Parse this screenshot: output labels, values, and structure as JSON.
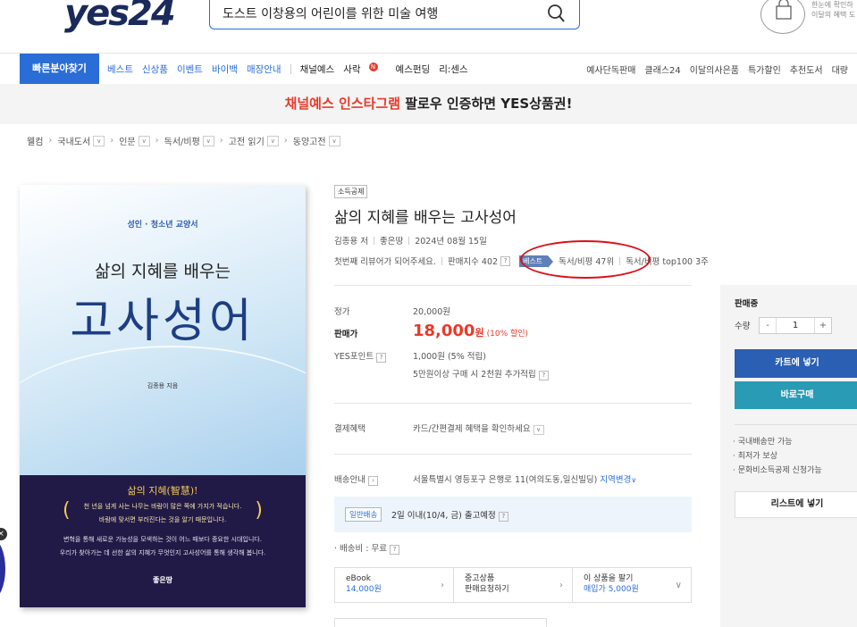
{
  "header": {
    "logo": "yes24",
    "search_value": "도스트 이창용의 어린이를 위한 미술 여행",
    "cart_hint_line1": "한눈에 확인하",
    "cart_hint_line2": "이달의 혜택 도"
  },
  "nav": {
    "quick_button": "빠른분야찾기",
    "items_blue": [
      "베스트",
      "신상품",
      "이벤트",
      "바이백",
      "매장안내"
    ],
    "items_dark": [
      "채널예스",
      "사락",
      "예스펀딩",
      "리:센스"
    ],
    "sarak_badge": "N",
    "items_right": [
      "예사단독판매",
      "클래스24",
      "이달의사은품",
      "특가할인",
      "추천도서",
      "대량"
    ]
  },
  "promo": {
    "red_text": "채널예스 인스타그램",
    "black_text": " 팔로우 인증하면 YES상품권!"
  },
  "breadcrumb": [
    "웰컴",
    "국내도서",
    "인문",
    "독서/비평",
    "고전 읽기",
    "동양고전"
  ],
  "cover": {
    "subtitle": "성인 · 청소년 교양서",
    "title_line1": "삶의 지혜를 배우는",
    "title_line2": "고사성어",
    "author": "김종용 지음",
    "bottom_title": "삶의 지혜(智慧)!",
    "bottom_line1": "천 년을 넘게 사는 나무는 바람이 많은 쪽에 가지가 적습니다.",
    "bottom_line2": "바람에 맞서면 부러진다는 것을 알기 때문입니다.",
    "bottom_line3": "변혁을 통해 새로운 가능성을 모색하는 것이 어느 때보다 중요한 시대입니다.",
    "bottom_line4": "우리가 찾아가는 데 선한 삶의 지혜가 무엇인지 고사성어를 통해 생각해 봅니다.",
    "publisher": "좋은땅"
  },
  "product": {
    "tag": "소득공제",
    "title": "삶의 지혜를 배우는 고사성어",
    "author": "김종용 저",
    "publisher": "좋은땅",
    "date": "2024년 08월 15일",
    "review_prompt": "첫번째 리뷰어가 되어주세요.",
    "sales_index": "판매지수 402",
    "best_badge": "베스트",
    "rank_text": "독서/비평 47위",
    "rank_top": "독서/비평 top100 3주"
  },
  "pricing": {
    "list_price_label": "정가",
    "list_price": "20,000원",
    "sale_label": "판매가",
    "sale_price": "18,000",
    "sale_unit": "원",
    "discount": "(10% 할인)",
    "points_label": "YES포인트",
    "points": "1,000원 (5% 적립)",
    "points_extra": "5만원이상 구매 시 2천원 추가적립"
  },
  "payment": {
    "label": "결제혜택",
    "value": "카드/간편결제 혜택을 확인하세요"
  },
  "delivery": {
    "label": "배송안내",
    "address": "서울특별시 영등포구 은행로 11(여의도동,일신빌딩)",
    "change": "지역변경",
    "type": "일반배송",
    "eta": "2일 이내(10/4, 금) 출고예정",
    "fee": "· 배송비 : 무료"
  },
  "cards": [
    {
      "title": "eBook",
      "sub": "14,000원"
    },
    {
      "title": "중고상품",
      "sub": "판매요청하기"
    },
    {
      "title": "이 상품을 팔기",
      "sub": "매입가 5,000원"
    }
  ],
  "side_panel": {
    "title": "판매중",
    "qty_label": "수량",
    "qty_value": "1",
    "minus": "-",
    "plus": "+",
    "cart_button": "카트에 넣기",
    "buy_button": "바로구매",
    "notes": [
      "· 국내배송만 가능",
      "· 최저가 보상",
      "· 문화비소득공제 신청가능"
    ],
    "list_button": "리스트에 넣기"
  },
  "colors": {
    "accent_blue": "#2b6dd6",
    "price_red": "#e83a2a",
    "cover_navy": "#221a46",
    "annotation_red": "#d9121a"
  }
}
